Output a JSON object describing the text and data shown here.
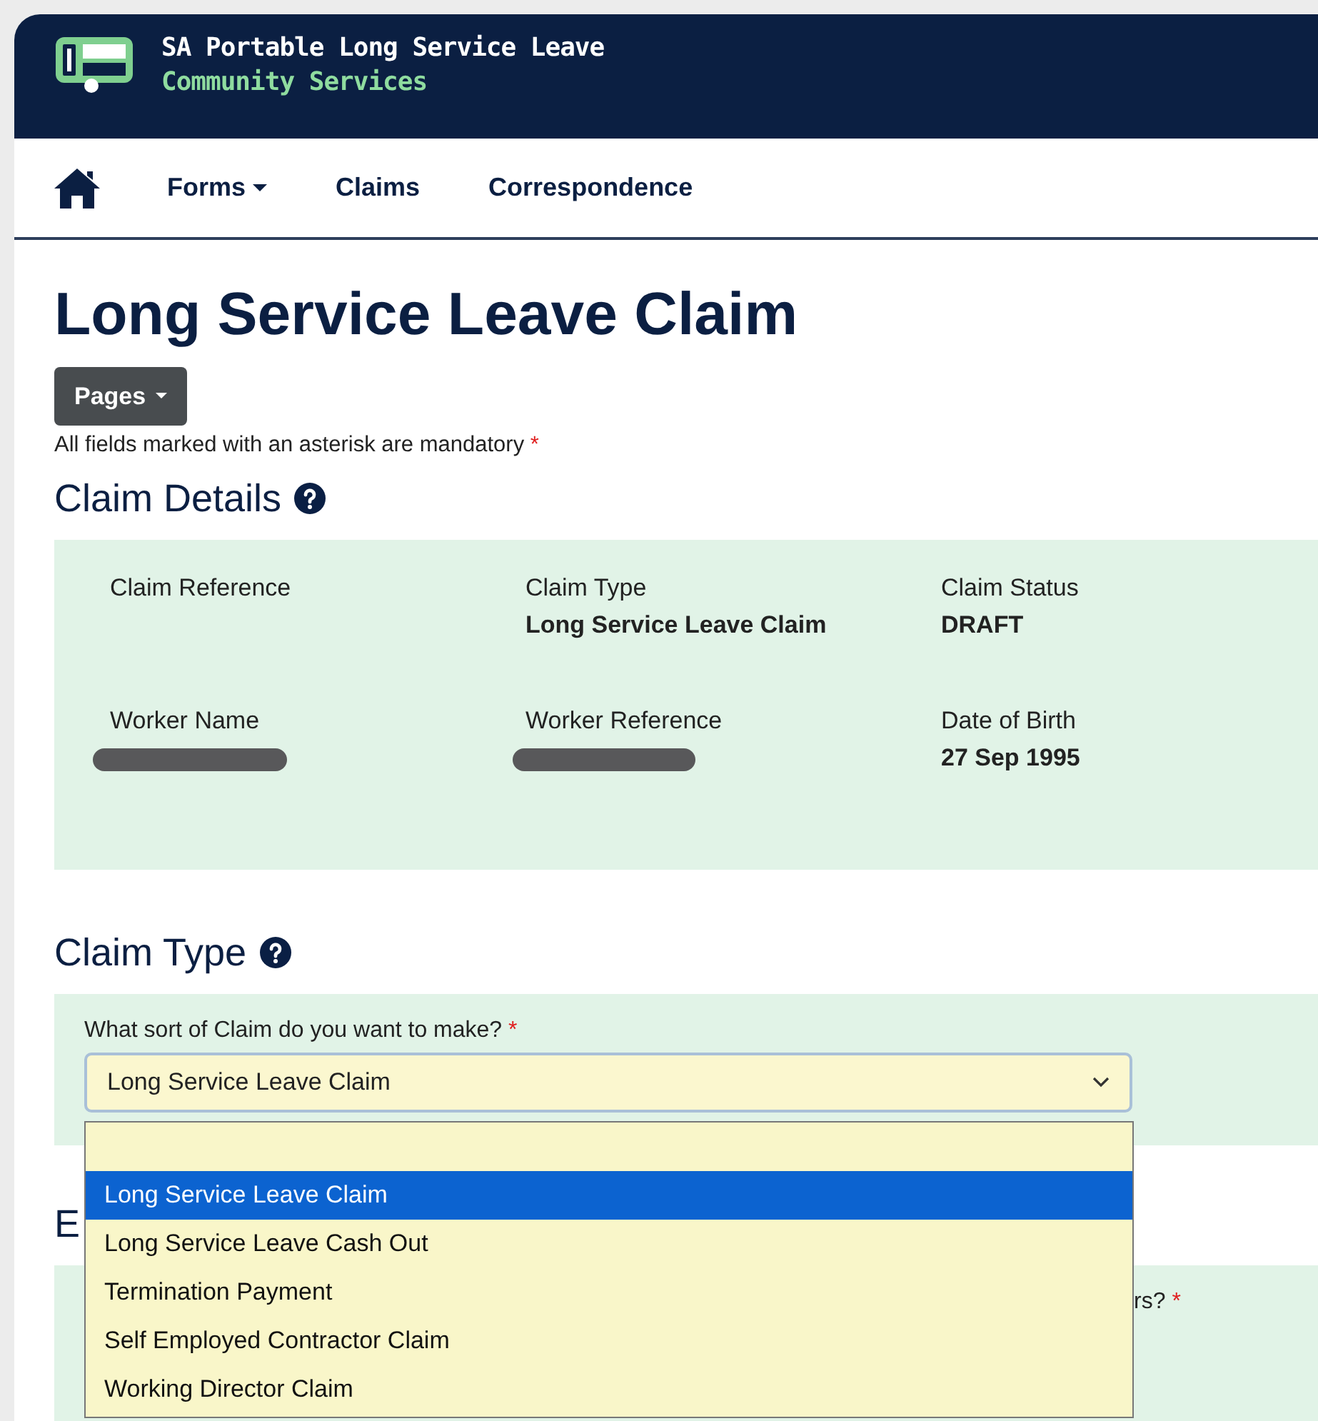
{
  "header": {
    "title": "SA Portable Long Service Leave",
    "subtitle": "Community Services"
  },
  "nav": [
    {
      "label": "Forms",
      "dropdown": true
    },
    {
      "label": "Claims",
      "dropdown": false
    },
    {
      "label": "Correspondence",
      "dropdown": false
    }
  ],
  "page_title": "Long Service Leave Claim",
  "pages_button": "Pages",
  "mandatory_note": {
    "text": "All fields marked with an asterisk are mandatory",
    "asterisk": "*"
  },
  "claim_details": {
    "heading": "Claim Details",
    "rows": [
      [
        {
          "label": "Claim Reference"
        },
        {
          "label": "Claim Type",
          "value": "Long Service Leave Claim"
        },
        {
          "label": "Claim Status",
          "value": "DRAFT"
        }
      ],
      [
        {
          "label": "Worker Name",
          "redacted": true
        },
        {
          "label": "Worker Reference",
          "redacted": true
        },
        {
          "label": "Date of Birth",
          "value": "27 Sep 1995"
        }
      ]
    ]
  },
  "claim_type": {
    "heading": "Claim Type",
    "question": "What sort of Claim do you want to make?",
    "asterisk": "*",
    "value": "Long Service Leave Claim",
    "expanded": true,
    "options": [
      {
        "label": "Long Service Leave Claim",
        "selected": true
      },
      {
        "label": "Long Service Leave Cash Out",
        "selected": false
      },
      {
        "label": "Termination Payment",
        "selected": false
      },
      {
        "label": "Self Employed Contractor Claim",
        "selected": false
      },
      {
        "label": "Working Director Claim",
        "selected": false
      }
    ]
  },
  "next_section": {
    "heading": "E",
    "question": "rs?",
    "asterisk": "*"
  }
}
